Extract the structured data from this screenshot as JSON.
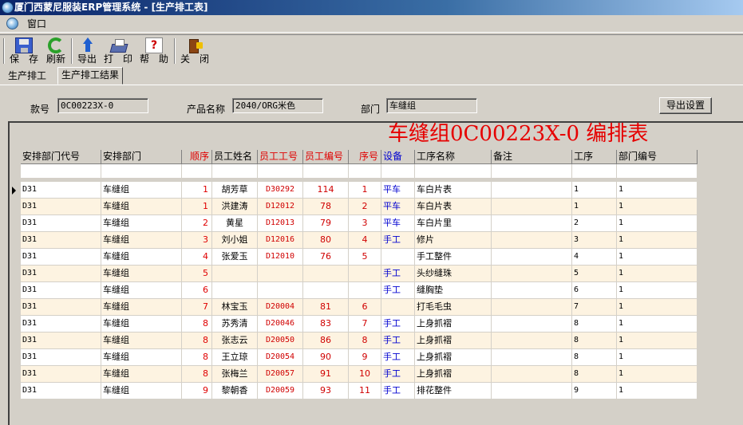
{
  "window": {
    "title": "厦门西蒙尼服装ERP管理系统 - [生产排工表]"
  },
  "menu": {
    "items": [
      "窗口"
    ]
  },
  "toolbar": {
    "save": "保　存",
    "refresh": "刷新",
    "export": "导出",
    "print": "打　印",
    "help": "帮　助",
    "close": "关　闭",
    "help_glyph": "?"
  },
  "tabs": [
    "生产排工",
    "生产排工结果"
  ],
  "form": {
    "style_label": "款号",
    "style_value": "0C00223X-0",
    "product_label": "产品名称",
    "product_value": "2040/ORG米色",
    "dept_label": "部门",
    "dept_value": "车缝组",
    "export_settings": "导出设置"
  },
  "report": {
    "title": "车缝组0C00223X-0 编排表",
    "title_color": "#e60000",
    "columns": [
      "安排部门代号",
      "安排部门",
      "顺序",
      "员工姓名",
      "员工工号",
      "员工编号",
      "序号",
      "设备",
      "工序名称",
      "备注",
      "工序",
      "部门编号"
    ],
    "rows": [
      [
        "D31",
        "车缝组",
        "1",
        "胡芳草",
        "D30292",
        "114",
        "1",
        "平车",
        "车白片表",
        "",
        "1",
        "1"
      ],
      [
        "D31",
        "车缝组",
        "1",
        "洪建涛",
        "D12012",
        "78",
        "2",
        "平车",
        "车白片表",
        "",
        "1",
        "1"
      ],
      [
        "D31",
        "车缝组",
        "2",
        "黄星",
        "D12013",
        "79",
        "3",
        "平车",
        "车白片里",
        "",
        "2",
        "1"
      ],
      [
        "D31",
        "车缝组",
        "3",
        "刘小姐",
        "D12016",
        "80",
        "4",
        "手工",
        "修片",
        "",
        "3",
        "1"
      ],
      [
        "D31",
        "车缝组",
        "4",
        "张爱玉",
        "D12010",
        "76",
        "5",
        "",
        "手工整件",
        "",
        "4",
        "1"
      ],
      [
        "D31",
        "车缝组",
        "5",
        "",
        "",
        "",
        "",
        "手工",
        "头纱缝珠",
        "",
        "5",
        "1"
      ],
      [
        "D31",
        "车缝组",
        "6",
        "",
        "",
        "",
        "",
        "手工",
        "缝胸垫",
        "",
        "6",
        "1"
      ],
      [
        "D31",
        "车缝组",
        "7",
        "林宝玉",
        "D20004",
        "81",
        "6",
        "",
        "打毛毛虫",
        "",
        "7",
        "1"
      ],
      [
        "D31",
        "车缝组",
        "8",
        "苏秀清",
        "D20046",
        "83",
        "7",
        "手工",
        "上身抓褶",
        "",
        "8",
        "1"
      ],
      [
        "D31",
        "车缝组",
        "8",
        "张志云",
        "D20050",
        "86",
        "8",
        "手工",
        "上身抓褶",
        "",
        "8",
        "1"
      ],
      [
        "D31",
        "车缝组",
        "8",
        "王立琼",
        "D20054",
        "90",
        "9",
        "手工",
        "上身抓褶",
        "",
        "8",
        "1"
      ],
      [
        "D31",
        "车缝组",
        "8",
        "张梅兰",
        "D20057",
        "91",
        "10",
        "手工",
        "上身抓褶",
        "",
        "8",
        "1"
      ],
      [
        "D31",
        "车缝组",
        "9",
        "黎朝香",
        "D20059",
        "93",
        "11",
        "手工",
        "排花整件",
        "",
        "9",
        "1"
      ]
    ]
  }
}
